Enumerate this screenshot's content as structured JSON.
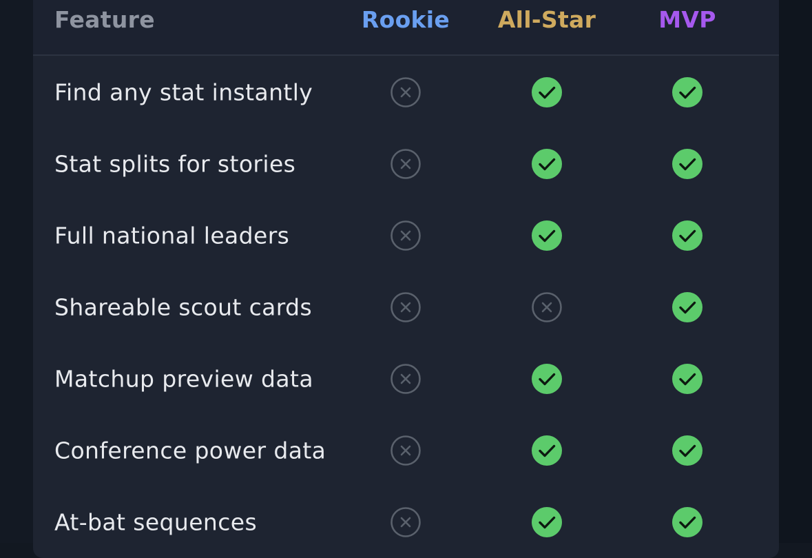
{
  "header": {
    "feature": "Feature",
    "tiers": [
      {
        "name": "Rookie",
        "color": "#6a9ff0"
      },
      {
        "name": "All-Star",
        "color": "#cfaa5e"
      },
      {
        "name": "MVP",
        "color": "#a659ee"
      }
    ]
  },
  "colors": {
    "included": "#5ccb6b",
    "excluded": "#5a616c"
  },
  "rows": [
    {
      "feature": "Find any stat instantly",
      "rookie": false,
      "allstar": true,
      "mvp": true
    },
    {
      "feature": "Stat splits for stories",
      "rookie": false,
      "allstar": true,
      "mvp": true
    },
    {
      "feature": "Full national leaders",
      "rookie": false,
      "allstar": true,
      "mvp": true
    },
    {
      "feature": "Shareable scout cards",
      "rookie": false,
      "allstar": false,
      "mvp": true
    },
    {
      "feature": "Matchup preview data",
      "rookie": false,
      "allstar": true,
      "mvp": true
    },
    {
      "feature": "Conference power data",
      "rookie": false,
      "allstar": true,
      "mvp": true
    },
    {
      "feature": "At-bat sequences",
      "rookie": false,
      "allstar": true,
      "mvp": true
    }
  ]
}
